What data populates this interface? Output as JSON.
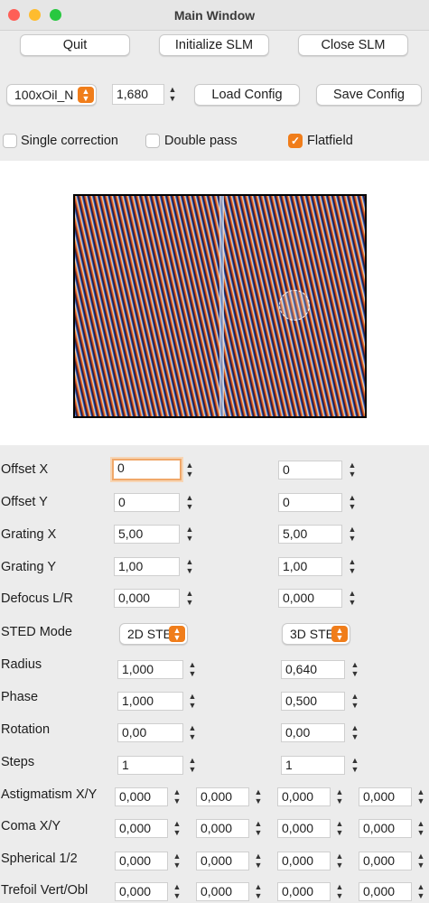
{
  "window": {
    "title": "Main Window",
    "colors": {
      "close": "#fe5f57",
      "minimize": "#febc2e",
      "zoom": "#28c840",
      "accent": "#f07d1a"
    }
  },
  "toolbar": {
    "quit_label": "Quit",
    "init_label": "Initialize SLM",
    "close_label": "Close SLM"
  },
  "config": {
    "objective_value": "100xOil_N",
    "wavelength_value": "1,680",
    "load_label": "Load Config",
    "save_label": "Save Config"
  },
  "options": {
    "single_correction": {
      "label": "Single correction",
      "checked": false
    },
    "double_pass": {
      "label": "Double pass",
      "checked": false
    },
    "flatfield": {
      "label": "Flatfield",
      "checked": true
    }
  },
  "params": {
    "offset_x": {
      "label": "Offset X",
      "left": "0",
      "right": "0"
    },
    "offset_y": {
      "label": "Offset Y",
      "left": "0",
      "right": "0"
    },
    "grating_x": {
      "label": "Grating X",
      "left": "5,00",
      "right": "5,00"
    },
    "grating_y": {
      "label": "Grating Y",
      "left": "1,00",
      "right": "1,00"
    },
    "defocus": {
      "label": "Defocus L/R",
      "left": "0,000",
      "right": "0,000"
    },
    "sted_mode": {
      "label": "STED Mode",
      "left": "2D STE",
      "right": "3D STE"
    },
    "radius": {
      "label": "Radius",
      "left": "1,000",
      "right": "0,640"
    },
    "phase": {
      "label": "Phase",
      "left": "1,000",
      "right": "0,500"
    },
    "rotation": {
      "label": "Rotation",
      "left": "0,00",
      "right": "0,00"
    },
    "steps": {
      "label": "Steps",
      "left": "1",
      "right": "1"
    }
  },
  "aberrations": {
    "astig": {
      "label": "Astigmatism X/Y",
      "v": [
        "0,000",
        "0,000",
        "0,000",
        "0,000"
      ]
    },
    "coma": {
      "label": "Coma X/Y",
      "v": [
        "0,000",
        "0,000",
        "0,000",
        "0,000"
      ]
    },
    "spherical": {
      "label": "Spherical 1/2",
      "v": [
        "0,000",
        "0,000",
        "0,000",
        "0,000"
      ]
    },
    "trefoil": {
      "label": "Trefoil Vert/Obl",
      "v": [
        "0,000",
        "0,000",
        "0,000",
        "0,000"
      ]
    }
  }
}
